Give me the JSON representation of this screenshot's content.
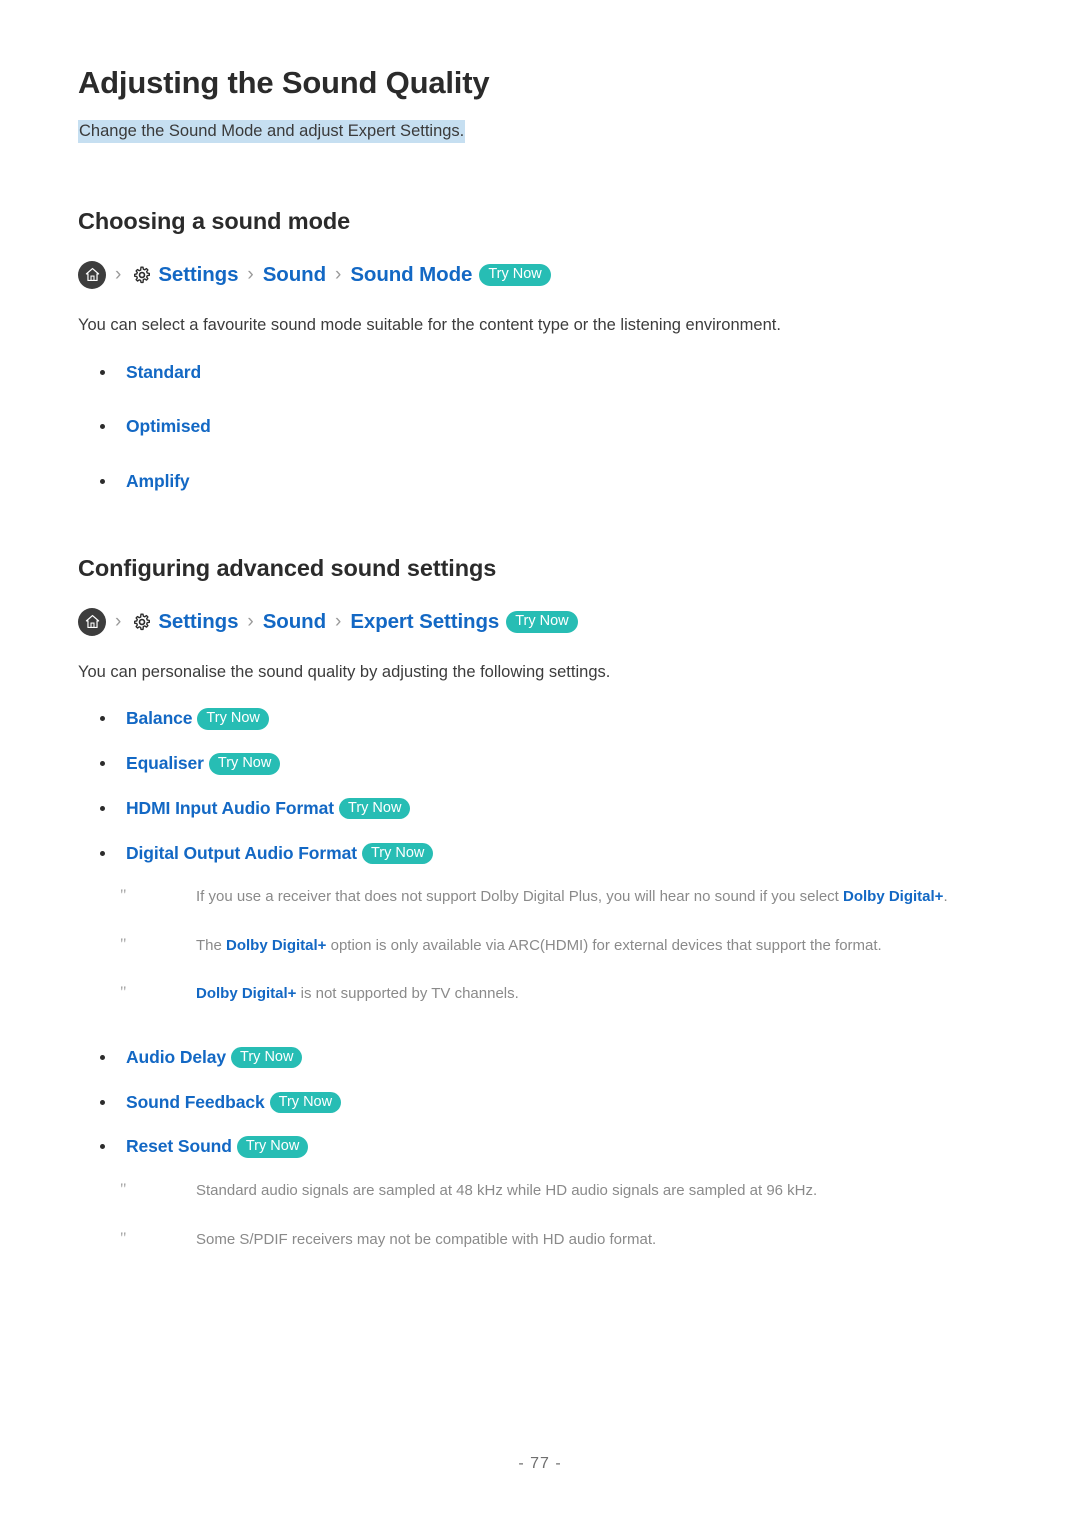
{
  "document": {
    "title": "Adjusting the Sound Quality",
    "subtitle": "Change the Sound Mode and adjust Expert Settings.",
    "page_number": "- 77 -"
  },
  "colors": {
    "link_blue": "#1368c4",
    "try_now_teal": "#27bdb4",
    "highlight_blue": "#c6dff1",
    "heading_dark": "#2b2b2b",
    "note_gray": "#8a8a8a"
  },
  "sections": [
    {
      "heading": "Choosing a sound mode",
      "breadcrumb": {
        "home_icon": "home-icon",
        "gear_icon": "gear-icon",
        "separator": "›",
        "items": [
          "Settings",
          "Sound",
          "Sound Mode"
        ],
        "try_now": "Try Now"
      },
      "intro": "You can select a favourite sound mode suitable for the content type or the listening environment.",
      "items": [
        {
          "label": "Standard",
          "try_now": null
        },
        {
          "label": "Optimised",
          "try_now": null
        },
        {
          "label": "Amplify",
          "try_now": null
        }
      ]
    },
    {
      "heading": "Configuring advanced sound settings",
      "breadcrumb": {
        "home_icon": "home-icon",
        "gear_icon": "gear-icon",
        "separator": "›",
        "items": [
          "Settings",
          "Sound",
          "Expert Settings"
        ],
        "try_now": "Try Now"
      },
      "intro": "You can personalise the sound quality by adjusting the following settings.",
      "items": [
        {
          "label": "Balance",
          "try_now": "Try Now"
        },
        {
          "label": "Equaliser",
          "try_now": "Try Now"
        },
        {
          "label": "HDMI Input Audio Format",
          "try_now": "Try Now"
        },
        {
          "label": "Digital Output Audio Format",
          "try_now": "Try Now"
        }
      ],
      "notes_after_items": [
        {
          "marker": "\"",
          "parts": [
            {
              "text": "If you use a receiver that does not support Dolby Digital Plus, you will hear no sound if you select ",
              "strong": false
            },
            {
              "text": "Dolby Digital+",
              "strong": true
            },
            {
              "text": ".",
              "strong": false
            }
          ]
        },
        {
          "marker": "\"",
          "parts": [
            {
              "text": "The ",
              "strong": false
            },
            {
              "text": "Dolby Digital+",
              "strong": true
            },
            {
              "text": " option is only available via ARC(HDMI) for external devices that support the format.",
              "strong": false
            }
          ]
        },
        {
          "marker": "\"",
          "parts": [
            {
              "text": "Dolby Digital+",
              "strong": true
            },
            {
              "text": " is not supported by TV channels.",
              "strong": false
            }
          ]
        }
      ],
      "items_continued": [
        {
          "label": "Audio Delay",
          "try_now": "Try Now"
        },
        {
          "label": "Sound Feedback",
          "try_now": "Try Now"
        },
        {
          "label": "Reset Sound",
          "try_now": "Try Now"
        }
      ],
      "notes_bottom": [
        {
          "marker": "\"",
          "parts": [
            {
              "text": "Standard audio signals are sampled at 48 kHz while HD audio signals are sampled at 96 kHz.",
              "strong": false
            }
          ]
        },
        {
          "marker": "\"",
          "parts": [
            {
              "text": "Some S/PDIF receivers may not be compatible with HD audio format.",
              "strong": false
            }
          ]
        }
      ]
    }
  ]
}
